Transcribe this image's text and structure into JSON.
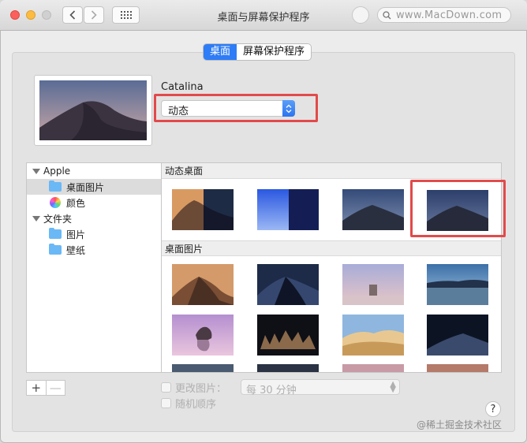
{
  "window": {
    "title": "桌面与屏幕保护程序",
    "watermark": "www.MacDown.com"
  },
  "tabs": [
    {
      "label": "桌面",
      "active": true
    },
    {
      "label": "屏幕保护程序",
      "active": false
    }
  ],
  "current": {
    "name": "Catalina",
    "mode_value": "动态"
  },
  "sidebar": {
    "groups": [
      {
        "label": "Apple",
        "items": [
          {
            "label": "桌面图片",
            "icon": "folder-icon",
            "selected": true
          },
          {
            "label": "颜色",
            "icon": "color-wheel-icon",
            "selected": false
          }
        ]
      },
      {
        "label": "文件夹",
        "items": [
          {
            "label": "图片",
            "icon": "folder-icon",
            "selected": false
          },
          {
            "label": "壁纸",
            "icon": "folder-icon",
            "selected": false
          }
        ]
      }
    ]
  },
  "gallery": {
    "sections": [
      {
        "title": "动态桌面"
      },
      {
        "title": "桌面图片"
      }
    ]
  },
  "controls": {
    "add_label": "+",
    "remove_label": "—",
    "change_picture_label": "更改图片：",
    "interval_value": "每 30 分钟",
    "random_order_label": "随机顺序",
    "help_label": "?"
  },
  "footer_watermark": "@稀土掘金技术社区",
  "colors": {
    "accent": "#2e7cf6",
    "highlight_box": "#e24a4a"
  }
}
